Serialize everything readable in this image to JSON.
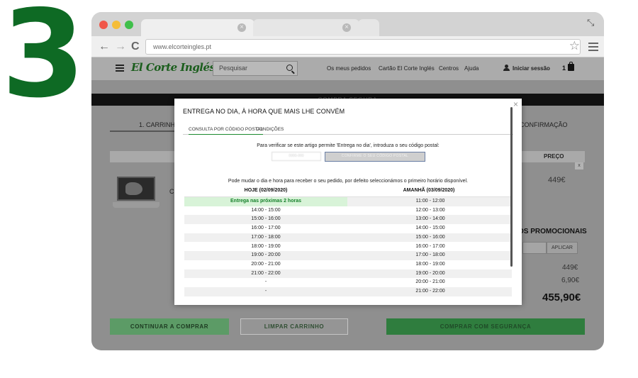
{
  "step_number": "3",
  "browser": {
    "url": "www.elcorteingles.pt",
    "tab_close": "×",
    "back": "←",
    "forward": "→",
    "reload": "C",
    "star": "☆",
    "expand": "⤡"
  },
  "header": {
    "logo": "El Corte Inglés",
    "search_placeholder": "Pesquisar",
    "links": [
      "Os meus pedidos",
      "Cartão El Corte Inglés",
      "Centros",
      "Ajuda"
    ],
    "login": "Iniciar sessão",
    "cart_count": "1"
  },
  "checkout": {
    "band_text": "COMPRA SEGURA",
    "step_1": "1. CARRINHO",
    "step_last": "CONFIRMAÇÃO",
    "price_header": "PREÇO",
    "remove": "x",
    "product_initial": "C",
    "item_price": "449€",
    "promo_title": "OS PROMOCIONAIS",
    "apply": "APLICAR",
    "subtotal": "449€",
    "shipping": "6,90€",
    "total": "455,90€",
    "continue_shopping": "CONTINUAR A COMPRAR",
    "clear_cart": "LIMPAR CARRINHO",
    "buy_securely": "COMPRAR COM SEGURANÇA"
  },
  "modal": {
    "close": "×",
    "title": "ENTREGA NO DIA, À HORA QUE MAIS LHE CONVÉM",
    "tabs": [
      "CONSULTA POR CÓDIGO POSTAL",
      "CONDIÇÕES"
    ],
    "postal_intro": "Para verificar se este artigo permite 'Entrega no dia', introduza o seu código postal:",
    "postal_value": "0000-000",
    "confirm_button": "CONFIRME O SEU CÓDIGO POSTAL",
    "change_note": "Pode mudar o dia e hora para receber o seu pedido, por defeito seleccionámos o primeiro horário disponível.",
    "today_header": "HOJE (02/09/2020)",
    "tomorrow_header": "AMANHÃ (03/09/2020)",
    "today_slots": [
      "Entrega nas próximas 2 horas",
      "14:00 - 15:00",
      "15:00 - 16:00",
      "16:00 - 17:00",
      "17:00 - 18:00",
      "18:00 - 19:00",
      "19:00 - 20:00",
      "20:00 - 21:00",
      "21:00 - 22:00",
      "-",
      "-"
    ],
    "tomorrow_slots": [
      "11:00 - 12:00",
      "12:00 - 13:00",
      "13:00 - 14:00",
      "14:00 - 15:00",
      "15:00 - 16:00",
      "16:00 - 17:00",
      "17:00 - 18:00",
      "18:00 - 19:00",
      "19:00 - 20:00",
      "20:00 - 21:00",
      "21:00 - 22:00"
    ]
  }
}
